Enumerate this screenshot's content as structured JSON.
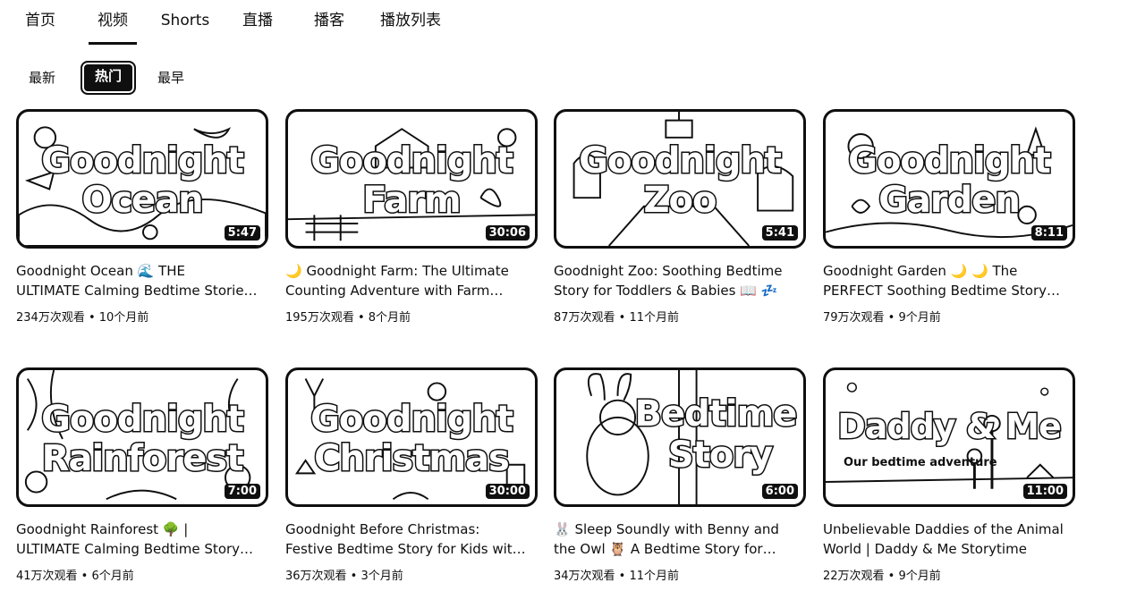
{
  "tabs": [
    {
      "label": "首页"
    },
    {
      "label": "视频",
      "active": true
    },
    {
      "label": "Shorts"
    },
    {
      "label": "直播"
    },
    {
      "label": "播客"
    },
    {
      "label": "播放列表"
    }
  ],
  "chips": [
    {
      "label": "最新"
    },
    {
      "label": "热门",
      "active": true
    },
    {
      "label": "最早"
    }
  ],
  "videos": [
    {
      "thumb_title_1": "Goodnight",
      "thumb_title_2": "Ocean",
      "thumb_sub": "",
      "duration": "5:47",
      "title_line1": "Goodnight Ocean 🌊 THE",
      "title_line2": "ULTIMATE Calming Bedtime Storie…",
      "views": "234万次观看",
      "age": "10个月前"
    },
    {
      "thumb_title_1": "Goodnight",
      "thumb_title_2": "Farm",
      "thumb_sub": "",
      "duration": "30:06",
      "title_line1": "🌙 Goodnight Farm: The Ultimate",
      "title_line2": "Counting Adventure with Farm…",
      "views": "195万次观看",
      "age": "8个月前"
    },
    {
      "thumb_title_1": "Goodnight",
      "thumb_title_2": "Zoo",
      "thumb_sub": "",
      "duration": "5:41",
      "title_line1": "Goodnight Zoo: Soothing Bedtime",
      "title_line2": "Story for Toddlers & Babies 📖 💤",
      "views": "87万次观看",
      "age": "11个月前"
    },
    {
      "thumb_title_1": "Goodnight",
      "thumb_title_2": "Garden",
      "thumb_sub": "",
      "duration": "8:11",
      "title_line1": "Goodnight Garden 🌙 🌙 The",
      "title_line2": "PERFECT Soothing Bedtime Story…",
      "views": "79万次观看",
      "age": "9个月前"
    },
    {
      "thumb_title_1": "Goodnight",
      "thumb_title_2": "Rainforest",
      "thumb_sub": "",
      "duration": "7:00",
      "title_line1": "Goodnight Rainforest 🌳 |",
      "title_line2": "ULTIMATE Calming Bedtime Story…",
      "views": "41万次观看",
      "age": "6个月前"
    },
    {
      "thumb_title_1": "Goodnight",
      "thumb_title_2": "Christmas",
      "thumb_sub": "",
      "duration": "30:00",
      "title_line1": "Goodnight Before Christmas:",
      "title_line2": "Festive Bedtime Story for Kids wit…",
      "views": "36万次观看",
      "age": "3个月前"
    },
    {
      "thumb_title_1": "Bedtime",
      "thumb_title_2": "Story",
      "thumb_sub": "",
      "duration": "6:00",
      "title_line1": "🐰 Sleep Soundly with Benny and",
      "title_line2": "the Owl 🦉 A Bedtime Story for…",
      "views": "34万次观看",
      "age": "11个月前"
    },
    {
      "thumb_title_1": "Daddy & Me",
      "thumb_title_2": "",
      "thumb_sub": "Our bedtime adventure",
      "duration": "11:00",
      "title_line1": "Unbelievable Daddies of the Animal",
      "title_line2": "World | Daddy & Me Storytime",
      "views": "22万次观看",
      "age": "9个月前"
    }
  ]
}
